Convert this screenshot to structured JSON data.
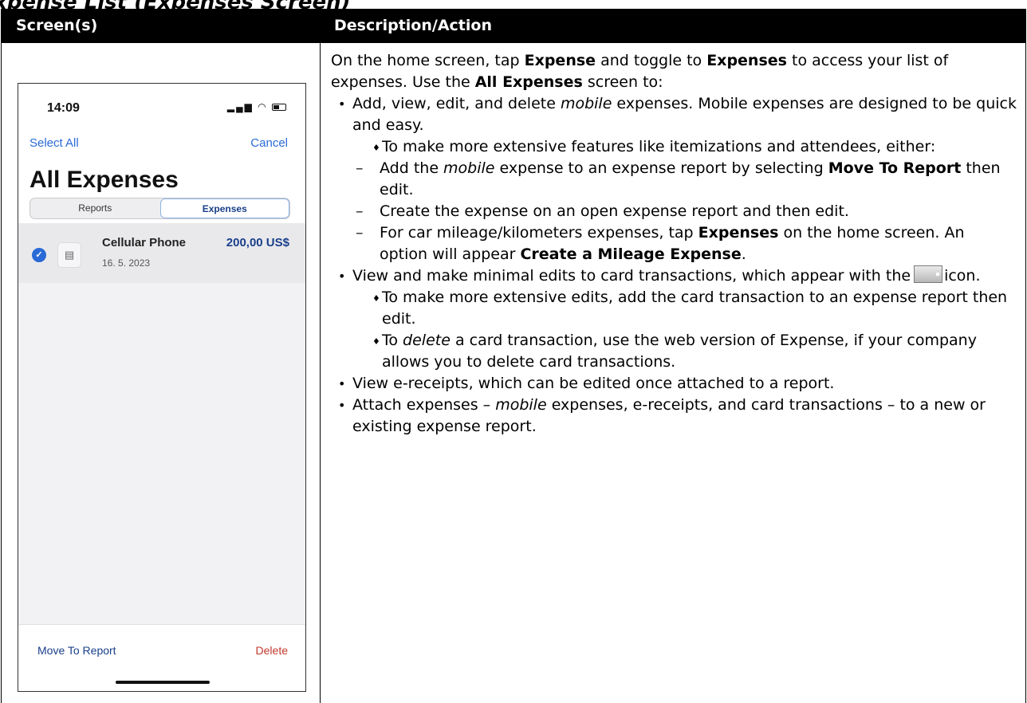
{
  "section": {
    "title": "xpense List (Expenses Screen)"
  },
  "table": {
    "col_screens": "Screen(s)",
    "col_description": "Description/Action"
  },
  "phone": {
    "status_time": "14:09",
    "select_all": "Select All",
    "cancel": "Cancel",
    "title": "All Expenses",
    "tabs": [
      "Reports",
      "Expenses"
    ],
    "selected_tab": "Expenses",
    "expense": {
      "name": "Cellular Phone",
      "date": "16. 5. 2023",
      "amount": "200,00 US$"
    },
    "move_to_report": "Move To Report",
    "delete": "Delete"
  },
  "description": {
    "intro": [
      "On the home screen, tap ",
      "Expense",
      " and toggle to ",
      "Expenses",
      " to access your list of expenses. Use the ",
      "All Expenses",
      " screen to:"
    ],
    "b1": [
      "Add, view, edit, and delete ",
      "mobile",
      " expenses. Mobile expenses are designed to be quick and easy."
    ],
    "b1_d1": "To make more extensive features like itemizations and attendees, either:",
    "b1_dash1": [
      "Add the ",
      "mobile",
      " expense to an expense report by selecting ",
      "Move To Report",
      " then edit."
    ],
    "b1_dash2": "Create the expense on an open expense report and then edit.",
    "b1_dash3": [
      "For car mileage/kilometers expenses, tap ",
      "Expenses",
      " on the home screen. An option will appear ",
      "Create a Mileage Expense",
      "."
    ],
    "b2": [
      "View and make minimal edits to card transactions, which appear with the",
      "icon."
    ],
    "b2_d1": "To make more extensive edits, add the card transaction to an expense report then edit.",
    "b2_d2": [
      "To ",
      "delete",
      " a card transaction, use the web version of Expense, if your company allows you to delete card transactions."
    ],
    "b3": "View e-receipts, which can be edited once attached to a report.",
    "b4": [
      "Attach expenses – ",
      "mobile",
      " expenses, e-receipts, and card transactions – to a new or existing expense report."
    ]
  },
  "colors": {
    "header_bg": "#000000",
    "link_blue": "#2a6ad6",
    "delete_red": "#c0392b"
  }
}
